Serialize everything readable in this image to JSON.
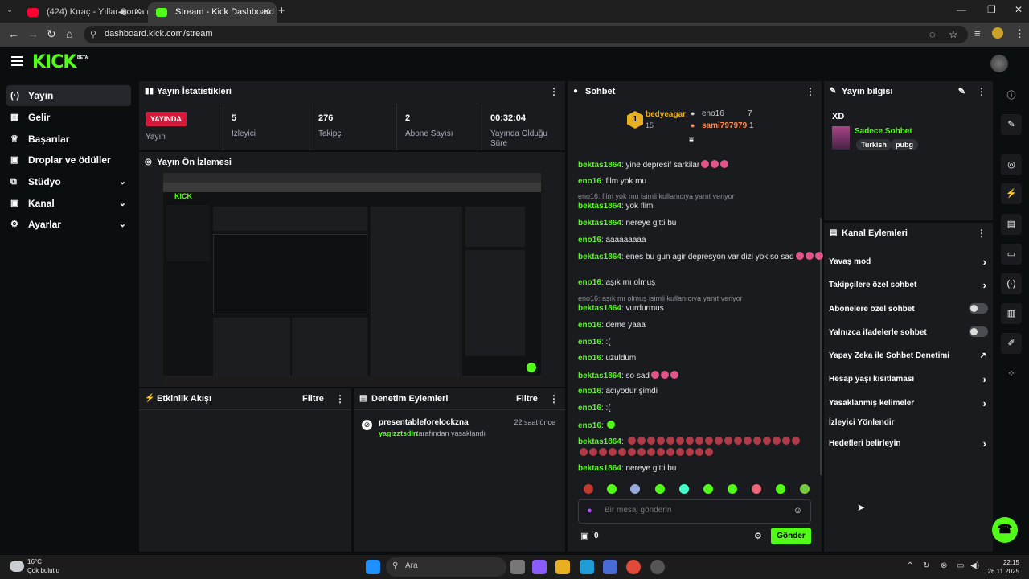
{
  "browser": {
    "tabs": [
      {
        "title": "(424) Kıraç - Yıllar Sonra (O"
      },
      {
        "title": "Stream - Kick Dashboard"
      }
    ],
    "url": "dashboard.kick.com/stream"
  },
  "header": {
    "logo": "KICK",
    "beta": "BETA"
  },
  "sidebar": {
    "items": [
      {
        "label": "Yayın",
        "icon": "broadcast-icon",
        "icon_glyph": "(·)"
      },
      {
        "label": "Gelir",
        "icon": "revenue-icon",
        "icon_glyph": "▦"
      },
      {
        "label": "Başarılar",
        "icon": "trophy-icon",
        "icon_glyph": "🏆"
      },
      {
        "label": "Droplar ve ödüller",
        "icon": "gift-icon",
        "icon_glyph": "▣"
      },
      {
        "label": "Stüdyo",
        "icon": "studio-icon",
        "icon_glyph": "⧉"
      },
      {
        "label": "Kanal",
        "icon": "channel-icon",
        "icon_glyph": "▣"
      },
      {
        "label": "Ayarlar",
        "icon": "gear-icon",
        "icon_glyph": "⚙"
      }
    ]
  },
  "stats": {
    "title": "Yayın İstatistikleri",
    "live_badge": "YAYINDA",
    "live_label": "Yayın",
    "items": [
      {
        "value": "5",
        "label": "İzleyici"
      },
      {
        "value": "276",
        "label": "Takipçi"
      },
      {
        "value": "2",
        "label": "Abone Sayısı"
      },
      {
        "value": "00:32:04",
        "label": "Yayında Olduğu Süre"
      }
    ]
  },
  "preview": {
    "title": "Yayın Ön İzlemesi"
  },
  "activity": {
    "title": "Etkinlik Akışı",
    "filter": "Filtre"
  },
  "moderation": {
    "title": "Denetim Eylemleri",
    "filter": "Filtre",
    "entry": {
      "user": "presentableforelockzna",
      "time": "22 saat önce",
      "by": "yagizztsdln",
      "action": "tarafından yasaklandı"
    }
  },
  "chat": {
    "title": "Sohbet",
    "leaderboard": {
      "first": {
        "rank": "1",
        "name": "bedyeagar",
        "count": "15"
      },
      "second": {
        "name": "eno16",
        "count": "7"
      },
      "third": {
        "name": "sami797979",
        "count": "1"
      }
    },
    "messages": [
      {
        "user": "bektas1864",
        "text": "yine depresif sarkilar",
        "emotes": 3
      },
      {
        "user": "eno16",
        "text": "film yok mu"
      },
      {
        "reply": "eno16: film yok mu isimli kullanıcıya yanıt veriyor"
      },
      {
        "user": "bektas1864",
        "text": "yok flim"
      },
      {
        "user": "bektas1864",
        "text": "nereye gitti bu"
      },
      {
        "user": "eno16",
        "text": "aaaaaaaaa"
      },
      {
        "user": "bektas1864",
        "text": "enes bu gun agir depresyon var dizi yok so sad",
        "emotes": 3
      },
      {
        "user": "eno16",
        "text": "aşık mı olmuş"
      },
      {
        "reply": "eno16: aşık mı olmuş isimli kullanıcıya yanıt veriyor"
      },
      {
        "user": "bektas1864",
        "text": "vurdurmus"
      },
      {
        "user": "eno16",
        "text": "deme yaaa"
      },
      {
        "user": "eno16",
        "text": ":("
      },
      {
        "user": "eno16",
        "text": "üzüldüm"
      },
      {
        "user": "bektas1864",
        "text": "so sad",
        "emotes": 3
      },
      {
        "user": "eno16",
        "text": "acıyodur şimdi"
      },
      {
        "user": "eno16",
        "text": ":("
      },
      {
        "user": "eno16",
        "text": "",
        "emotes": 1
      },
      {
        "user": "bektas1864",
        "text": "",
        "emotes": 32
      },
      {
        "user": "bektas1864",
        "text": "nereye gitti bu"
      }
    ],
    "placeholder": "Bir mesaj gönderin",
    "points": "0",
    "send": "Gönder"
  },
  "stream_info": {
    "title": "Yayın bilgisi",
    "stream_title": "XD",
    "category": "Sadece Sohbet",
    "tags": [
      "Turkish",
      "pubg"
    ]
  },
  "channel_actions": {
    "title": "Kanal Eylemleri",
    "items": [
      {
        "label": "Yavaş mod",
        "control": "arrow"
      },
      {
        "label": "Takipçilere özel sohbet",
        "control": "arrow"
      },
      {
        "label": "Abonelere özel sohbet",
        "control": "toggle"
      },
      {
        "label": "Yalnızca ifadelerle sohbet",
        "control": "toggle"
      },
      {
        "label": "Yapay Zeka ile Sohbet Denetimi",
        "control": "external"
      },
      {
        "label": "Hesap yaşı kısıtlaması",
        "control": "arrow"
      },
      {
        "label": "Yasaklanmış kelimeler",
        "control": "arrow"
      },
      {
        "label": "İzleyici Yönlendir",
        "control": "none"
      },
      {
        "label": "Hedefleri belirleyin",
        "control": "arrow"
      }
    ]
  },
  "taskbar": {
    "temp": "16°C",
    "weather": "Çok bulutlu",
    "search": "Ara",
    "time": "22:15",
    "date": "26.11.2025"
  },
  "colors": {
    "accent": "#53fc18",
    "live": "#d6183a",
    "panel": "#191b1f"
  }
}
